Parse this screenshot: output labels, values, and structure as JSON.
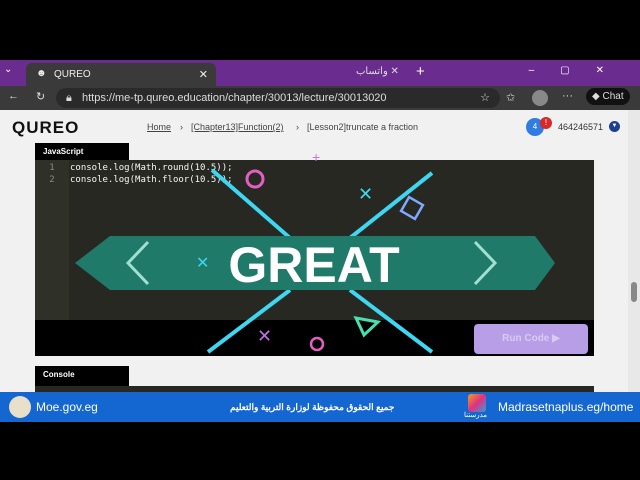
{
  "browser": {
    "tab_title": "QUREO",
    "tab2_title": "واتساب",
    "url": "https://me-tp.qureo.education/chapter/30013/lecture/30013020",
    "chat_label": "Chat"
  },
  "header": {
    "logo": "QUREO",
    "breadcrumb": [
      "Home",
      "[Chapter13]Function(2)",
      "[Lesson2]truncate a fraction"
    ],
    "notif_count": "4",
    "alert": "!",
    "user_id": "464246571"
  },
  "editor": {
    "language": "JavaScript",
    "lines": [
      {
        "n": "1",
        "code": "console.log(Math.round(10.5));"
      },
      {
        "n": "2",
        "code": "console.log(Math.floor(10.5));"
      }
    ],
    "run_label": "Run Code ▶"
  },
  "overlay": {
    "text": "GREAT"
  },
  "console": {
    "label": "Console"
  },
  "footer": {
    "left": "Moe.gov.eg",
    "center": "جميع الحقوق محفوظة لوزارة التربية والتعليم",
    "right": "Madrasetnaplus.eg/home",
    "logo_text": "مدرستنا"
  }
}
